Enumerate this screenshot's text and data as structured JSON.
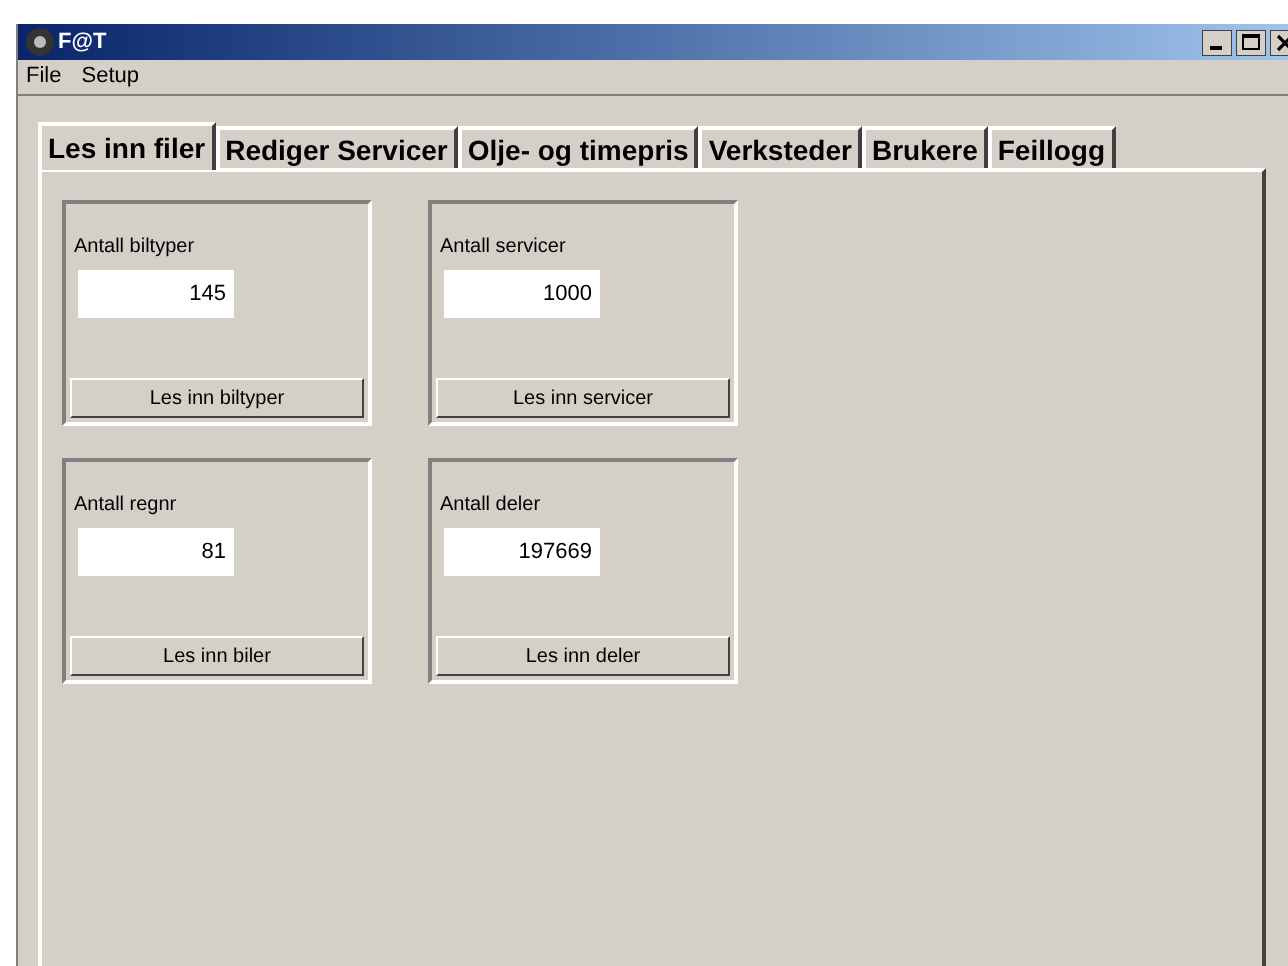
{
  "window": {
    "title": "F@T"
  },
  "menu": [
    "File",
    "Setup"
  ],
  "tabs": [
    {
      "label": "Les inn filer",
      "selected": true
    },
    {
      "label": "Rediger Servicer",
      "selected": false
    },
    {
      "label": "Olje- og timepris",
      "selected": false
    },
    {
      "label": "Verksteder",
      "selected": false
    },
    {
      "label": "Brukere",
      "selected": false
    },
    {
      "label": "Feillogg",
      "selected": false
    }
  ],
  "cards": [
    {
      "label": "Antall biltyper",
      "value": "145",
      "button": "Les inn biltyper"
    },
    {
      "label": "Antall servicer",
      "value": "1000",
      "button": "Les inn servicer"
    },
    {
      "label": "Antall regnr",
      "value": "81",
      "button": "Les inn biler"
    },
    {
      "label": "Antall deler",
      "value": "197669",
      "button": "Les inn deler"
    }
  ]
}
